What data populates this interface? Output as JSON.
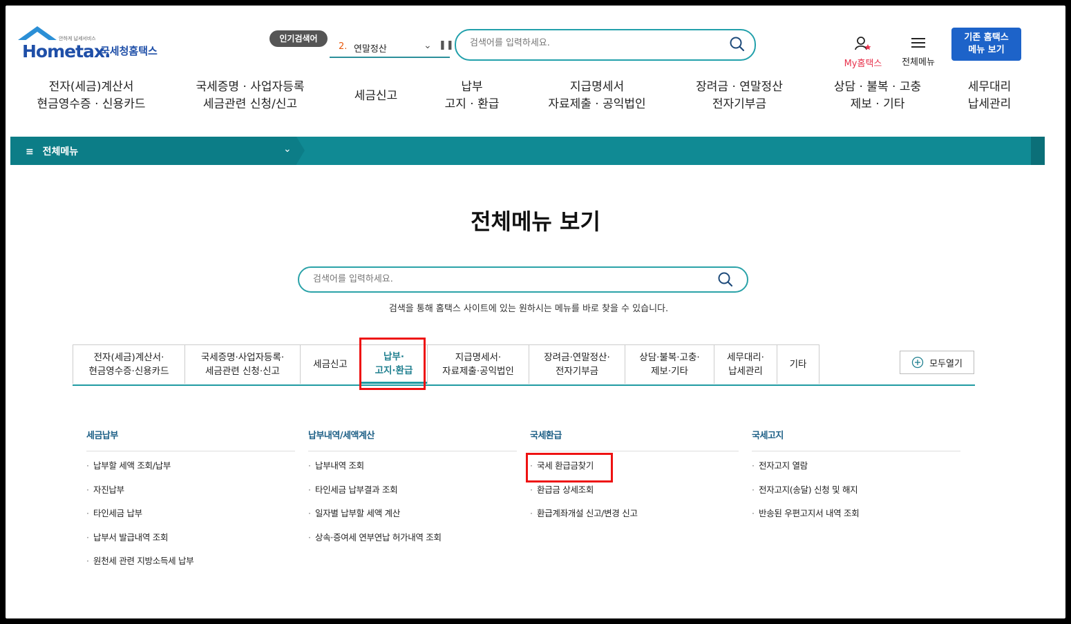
{
  "header": {
    "logo_text": "Hometax.",
    "logo_tagline": "안하게 납세서비스",
    "logo_name": "국세청홈택스",
    "popular_badge": "인기검색어",
    "popular_num": "2.",
    "popular_text": "연말정산",
    "search_placeholder": "검색어를 입력하세요.",
    "my_label": "My홈택스",
    "menu_label": "전체메뉴",
    "legacy_button": "기존 홈택스\n메뉴 보기"
  },
  "gnb": [
    "전자(세금)계산서\n현금영수증 · 신용카드",
    "국세증명 · 사업자등록\n세금관련 신청/신고",
    "세금신고",
    "납부\n고지 · 환급",
    "지급명세서\n자료제출 · 공익법인",
    "장려금 · 연말정산\n전자기부금",
    "상담 · 불복 · 고충\n제보 · 기타",
    "세무대리\n납세관리"
  ],
  "subbar": {
    "label": "전체메뉴"
  },
  "main": {
    "title": "전체메뉴 보기",
    "search_placeholder": "검색어를 입력하세요.",
    "help_text": "검색을 통해 홈택스 사이트에 있는 원하시는 메뉴를 바로 찾을 수 있습니다."
  },
  "tabs": [
    "전자(세금)계산서·\n현금영수증·신용카드",
    "국세증명·사업자등록·\n세금관련 신청·신고",
    "세금신고",
    "납부·\n고지·환급",
    "지급명세서·\n자료제출·공익법인",
    "장려금·연말정산·\n전자기부금",
    "상담·불복·고충·\n제보·기타",
    "세무대리·\n납세관리",
    "기타"
  ],
  "active_tab": 3,
  "expand_all": "모두열기",
  "columns": [
    {
      "title": "세금납부",
      "items": [
        "납부할 세액 조회/납부",
        "자진납부",
        "타인세금 납부",
        "납부서 발급내역 조회",
        "원천세 관련 지방소득세 납부"
      ]
    },
    {
      "title": "납부내역/세액계산",
      "items": [
        "납부내역 조회",
        "타인세금 납부결과 조회",
        "일자별 납부할 세액 계산",
        "상속·증여세 연부연납 허가내역 조회"
      ]
    },
    {
      "title": "국세환급",
      "items": [
        "국세 환급금찾기",
        "환급금 상세조회",
        "환급계좌개설 신고/변경 신고"
      ]
    },
    {
      "title": "국세고지",
      "items": [
        "전자고지 열람",
        "전자고지(송달) 신청 및 해지",
        "반송된 우편고지서 내역 조회"
      ]
    }
  ],
  "colors": {
    "teal": "#108a94",
    "accent_blue": "#1d63c9",
    "highlight": "#ee1111"
  }
}
